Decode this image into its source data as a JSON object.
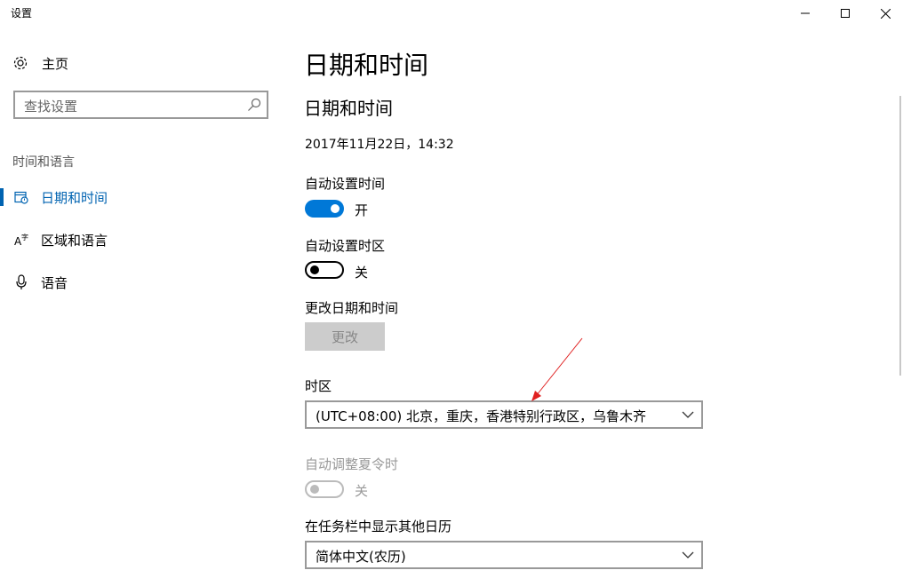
{
  "window": {
    "title": "设置"
  },
  "sidebar": {
    "home_label": "主页",
    "search_placeholder": "查找设置",
    "section_title": "时间和语言",
    "items": [
      {
        "label": "日期和时间",
        "icon": "calendar-clock-icon",
        "active": true
      },
      {
        "label": "区域和语言",
        "icon": "region-language-icon",
        "active": false
      },
      {
        "label": "语音",
        "icon": "microphone-icon",
        "active": false
      }
    ]
  },
  "main": {
    "page_title": "日期和时间",
    "section_title": "日期和时间",
    "current_datetime": "2017年11月22日，14:32",
    "auto_time": {
      "label": "自动设置时间",
      "state": "开",
      "on": true
    },
    "auto_timezone": {
      "label": "自动设置时区",
      "state": "关",
      "on": false
    },
    "change_datetime": {
      "label": "更改日期和时间",
      "button": "更改"
    },
    "timezone": {
      "label": "时区",
      "value": "(UTC+08:00) 北京，重庆，香港特别行政区，乌鲁木齐"
    },
    "dst": {
      "label": "自动调整夏令时",
      "state": "关",
      "enabled": false
    },
    "calendar": {
      "label": "在任务栏中显示其他日历",
      "value": "简体中文(农历)"
    }
  },
  "colors": {
    "accent": "#0078d7",
    "active_nav": "#0063b1",
    "annotation_arrow": "#e02020"
  }
}
